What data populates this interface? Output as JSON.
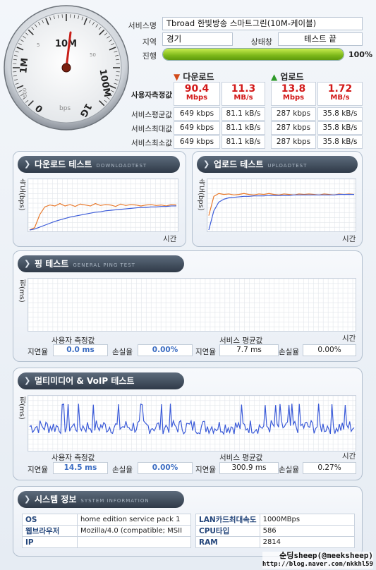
{
  "gauge": {
    "ticks": [
      "1M",
      "5",
      "10M",
      "50",
      "100M",
      "1G",
      "500",
      "bps"
    ],
    "ticks_extra": [
      "1M",
      "bps"
    ]
  },
  "info": {
    "service_name_label": "서비스명",
    "service_name_value": "Tbroad 한빛방송 스마트그린(10M-케이블)",
    "region_label": "지역",
    "region_value": "경기",
    "status_label": "상태창",
    "status_value": "테스트 끝",
    "progress_label": "진행",
    "progress_value": 100,
    "progress_text": "100%"
  },
  "speed": {
    "download_header": "다운로드",
    "upload_header": "업로드",
    "user_row_label": "사용자측정값",
    "user": {
      "dl_mbps": "90.4",
      "dl_mbps_unit": "Mbps",
      "dl_mbs": "11.3",
      "dl_mbs_unit": "MB/s",
      "ul_mbps": "13.8",
      "ul_mbps_unit": "Mbps",
      "ul_mbs": "1.72",
      "ul_mbs_unit": "MB/s"
    },
    "rows": [
      {
        "label": "서비스평균값",
        "dl1": "649 kbps",
        "dl2": "81.1 kB/s",
        "ul1": "287 kbps",
        "ul2": "35.8 kB/s"
      },
      {
        "label": "서비스최대값",
        "dl1": "649 kbps",
        "dl2": "81.1 kB/s",
        "ul1": "287 kbps",
        "ul2": "35.8 kB/s"
      },
      {
        "label": "서비스최소값",
        "dl1": "649 kbps",
        "dl2": "81.1 kB/s",
        "ul1": "287 kbps",
        "ul2": "35.8 kB/s"
      }
    ]
  },
  "download_test": {
    "title": "다운로드 테스트",
    "subtitle": "DOWNLOADTEST",
    "ylabel": "속도(bps)",
    "xlabel": "시간"
  },
  "upload_test": {
    "title": "업로드 테스트",
    "subtitle": "UPLOADTEST",
    "ylabel": "속도(bps)",
    "xlabel": "시간"
  },
  "ping_test": {
    "title": "핑 테스트",
    "subtitle": "GENERAL PING TEST",
    "ylabel": "핑(ms)",
    "xlabel": "시간",
    "user_header": "사용자 측정값",
    "service_header": "서비스 평균값",
    "latency_label": "지연율",
    "loss_label": "손실율",
    "user_latency": "0.0 ms",
    "user_loss": "0.00%",
    "service_latency": "7.7 ms",
    "service_loss": "0.00%"
  },
  "multimedia_test": {
    "title": "멀티미디어 & VoIP 테스트",
    "ylabel": "핑(ms)",
    "xlabel": "시간",
    "user_header": "사용자 측정값",
    "service_header": "서비스 평균값",
    "latency_label": "지연율",
    "loss_label": "손실율",
    "user_latency": "14.5 ms",
    "user_loss": "0.00%",
    "service_latency": "300.9 ms",
    "service_loss": "0.27%"
  },
  "system_info": {
    "title": "시스템 정보",
    "subtitle": "SYSTEM INFORMATION",
    "os_label": "OS",
    "os_value": "home edition service pack 1",
    "browser_label": "웹브라우저",
    "browser_value": "Mozilla/4.0 (compatible; MSII",
    "ip_label": "IP",
    "ip_value": "",
    "lan_label": "LAN카드최대속도",
    "lan_value": "1000MBps",
    "cpu_label": "CPU타입",
    "cpu_value": "586",
    "ram_label": "RAM",
    "ram_value": "2814"
  },
  "watermark": {
    "line1": "순딩sheep(@meeksheep)",
    "line2": "http://blog.naver.com/nkkhl59"
  },
  "colors": {
    "download_line": "#e8782a",
    "upload_line": "#e8782a",
    "avg_line": "#3a5ad8",
    "ping_line": "#3a5ad8",
    "accent_red": "#d21818",
    "progress_green": "#7cb81a"
  },
  "chart_data": [
    {
      "type": "line",
      "name": "download",
      "series": [
        {
          "name": "",
          "values": [
            0,
            5,
            32,
            48,
            52,
            50,
            55,
            50,
            53,
            49,
            54,
            52,
            50,
            55,
            51,
            53,
            52,
            49,
            54,
            51,
            53,
            52,
            50,
            52,
            53,
            51,
            52,
            50,
            53,
            52
          ]
        },
        {
          "name": "",
          "values": [
            0,
            2,
            6,
            10,
            14,
            18,
            21,
            24,
            27,
            29,
            31,
            33,
            35,
            37,
            38,
            40,
            41,
            42,
            43,
            44,
            45,
            46,
            47,
            47,
            48,
            48,
            49,
            49,
            50,
            50
          ]
        }
      ]
    },
    {
      "type": "line",
      "name": "upload",
      "series": [
        {
          "name": "",
          "values": [
            30,
            70,
            76,
            74,
            75,
            73,
            74,
            76,
            74,
            73,
            75,
            74,
            76,
            74,
            73,
            75,
            74,
            73,
            75,
            74,
            75,
            74,
            73,
            75,
            74,
            73,
            75,
            74,
            75,
            74
          ]
        },
        {
          "name": "",
          "values": [
            0,
            40,
            58,
            64,
            67,
            68,
            69,
            70,
            70,
            71,
            71,
            71,
            72,
            72,
            72,
            72,
            72,
            73,
            73,
            73,
            73,
            73,
            73,
            73,
            73,
            73,
            74,
            74,
            74,
            74
          ]
        }
      ]
    }
  ]
}
